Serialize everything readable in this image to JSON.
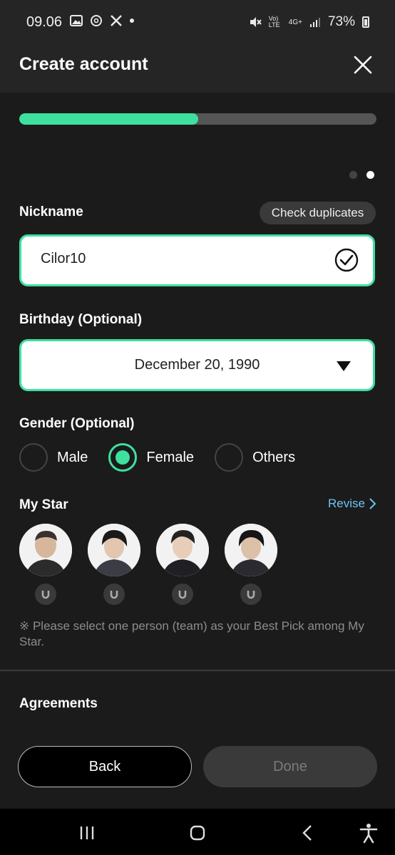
{
  "status_bar": {
    "time": "09.06",
    "battery": "73%",
    "icons": [
      "gallery-icon",
      "threads-icon",
      "x-icon",
      "notification-dot-icon",
      "mute-icon",
      "volte-icon",
      "4g-icon",
      "signal-icon",
      "battery-icon"
    ],
    "volte_label": "Vo) LTE",
    "network_label": "4G+"
  },
  "header": {
    "title": "Create account"
  },
  "progress": {
    "value": 0.5,
    "color": "#3ee0a0"
  },
  "page_indicator": {
    "count": 2,
    "active": 2
  },
  "nickname": {
    "label": "Nickname",
    "check_button": "Check duplicates",
    "value": "Cilor10"
  },
  "birthday": {
    "label": "Birthday (Optional)",
    "value": "December 20, 1990"
  },
  "gender": {
    "label": "Gender (Optional)",
    "options": [
      "Male",
      "Female",
      "Others"
    ],
    "selected": "Female"
  },
  "my_star": {
    "label": "My Star",
    "revise": "Revise",
    "stars_count": 4,
    "note": "※ Please select one person (team) as your Best Pick among My Star."
  },
  "agreements": {
    "label": "Agreements"
  },
  "actions": {
    "back": "Back",
    "done": "Done"
  },
  "colors": {
    "accent": "#3ee0a0",
    "link": "#6ec3f2",
    "background": "#1b1b1b"
  }
}
